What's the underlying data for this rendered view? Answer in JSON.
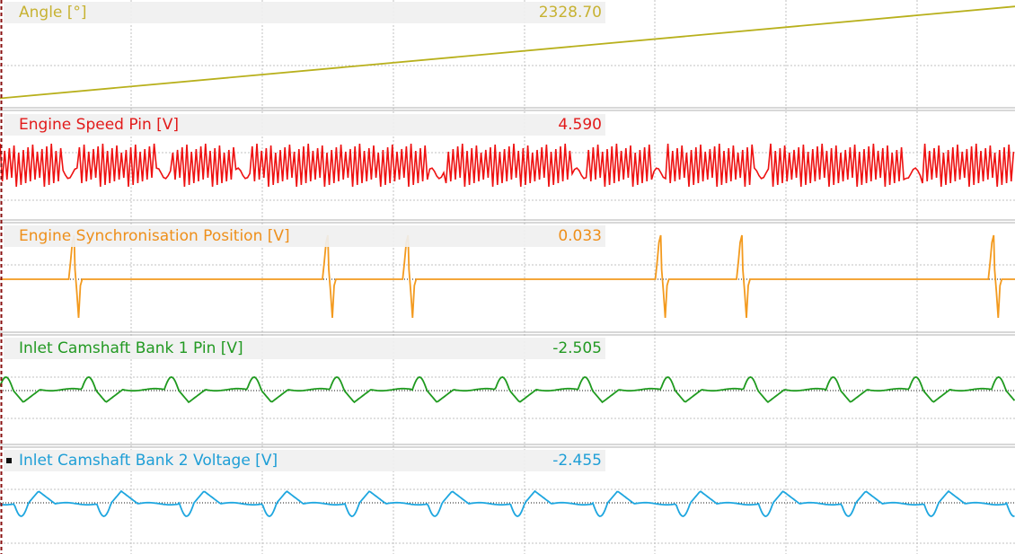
{
  "chart_data": [
    {
      "type": "line",
      "name": "Angle [°]",
      "readout": "2328.70",
      "color": "#b8b01c",
      "waveform": "ramp",
      "y_start_fraction": 0.05,
      "y_end_fraction": 0.98
    },
    {
      "type": "line",
      "name": "Engine Speed Pin [V]",
      "readout": "4.590",
      "color": "#ee1111",
      "waveform": "crank-tooth-signal",
      "gap_positions": [
        0.07,
        0.16,
        0.24,
        0.43,
        0.57,
        0.65,
        0.75,
        0.9
      ]
    },
    {
      "type": "line",
      "name": "Engine Synchronisation Position [V]",
      "readout": "0.033",
      "color": "#f39a1e",
      "waveform": "pulses",
      "pulse_positions": [
        0.073,
        0.323,
        0.402,
        0.651,
        0.731,
        0.979
      ]
    },
    {
      "type": "line",
      "name": "Inlet Camshaft Bank 1 Pin [V]",
      "readout": "-2.505",
      "color": "#1f9a1f",
      "waveform": "periodic",
      "period_fraction": 0.0815,
      "phase_fraction": 0.08,
      "polarity": 1,
      "zero_reference": "dotted"
    },
    {
      "type": "line",
      "name": "Inlet Camshaft Bank 2 Voltage [V]",
      "readout": "-2.455",
      "color": "#1ea6df",
      "waveform": "periodic",
      "period_fraction": 0.0815,
      "phase_fraction": 0.095,
      "polarity": -1,
      "zero_reference": "dotted",
      "selected": true
    }
  ],
  "grid": true,
  "colors": {
    "grid": "#c2c2c2",
    "separator": "#b0b0b0",
    "cursor": "#8a1010",
    "label_background": "#f0f0f0"
  }
}
